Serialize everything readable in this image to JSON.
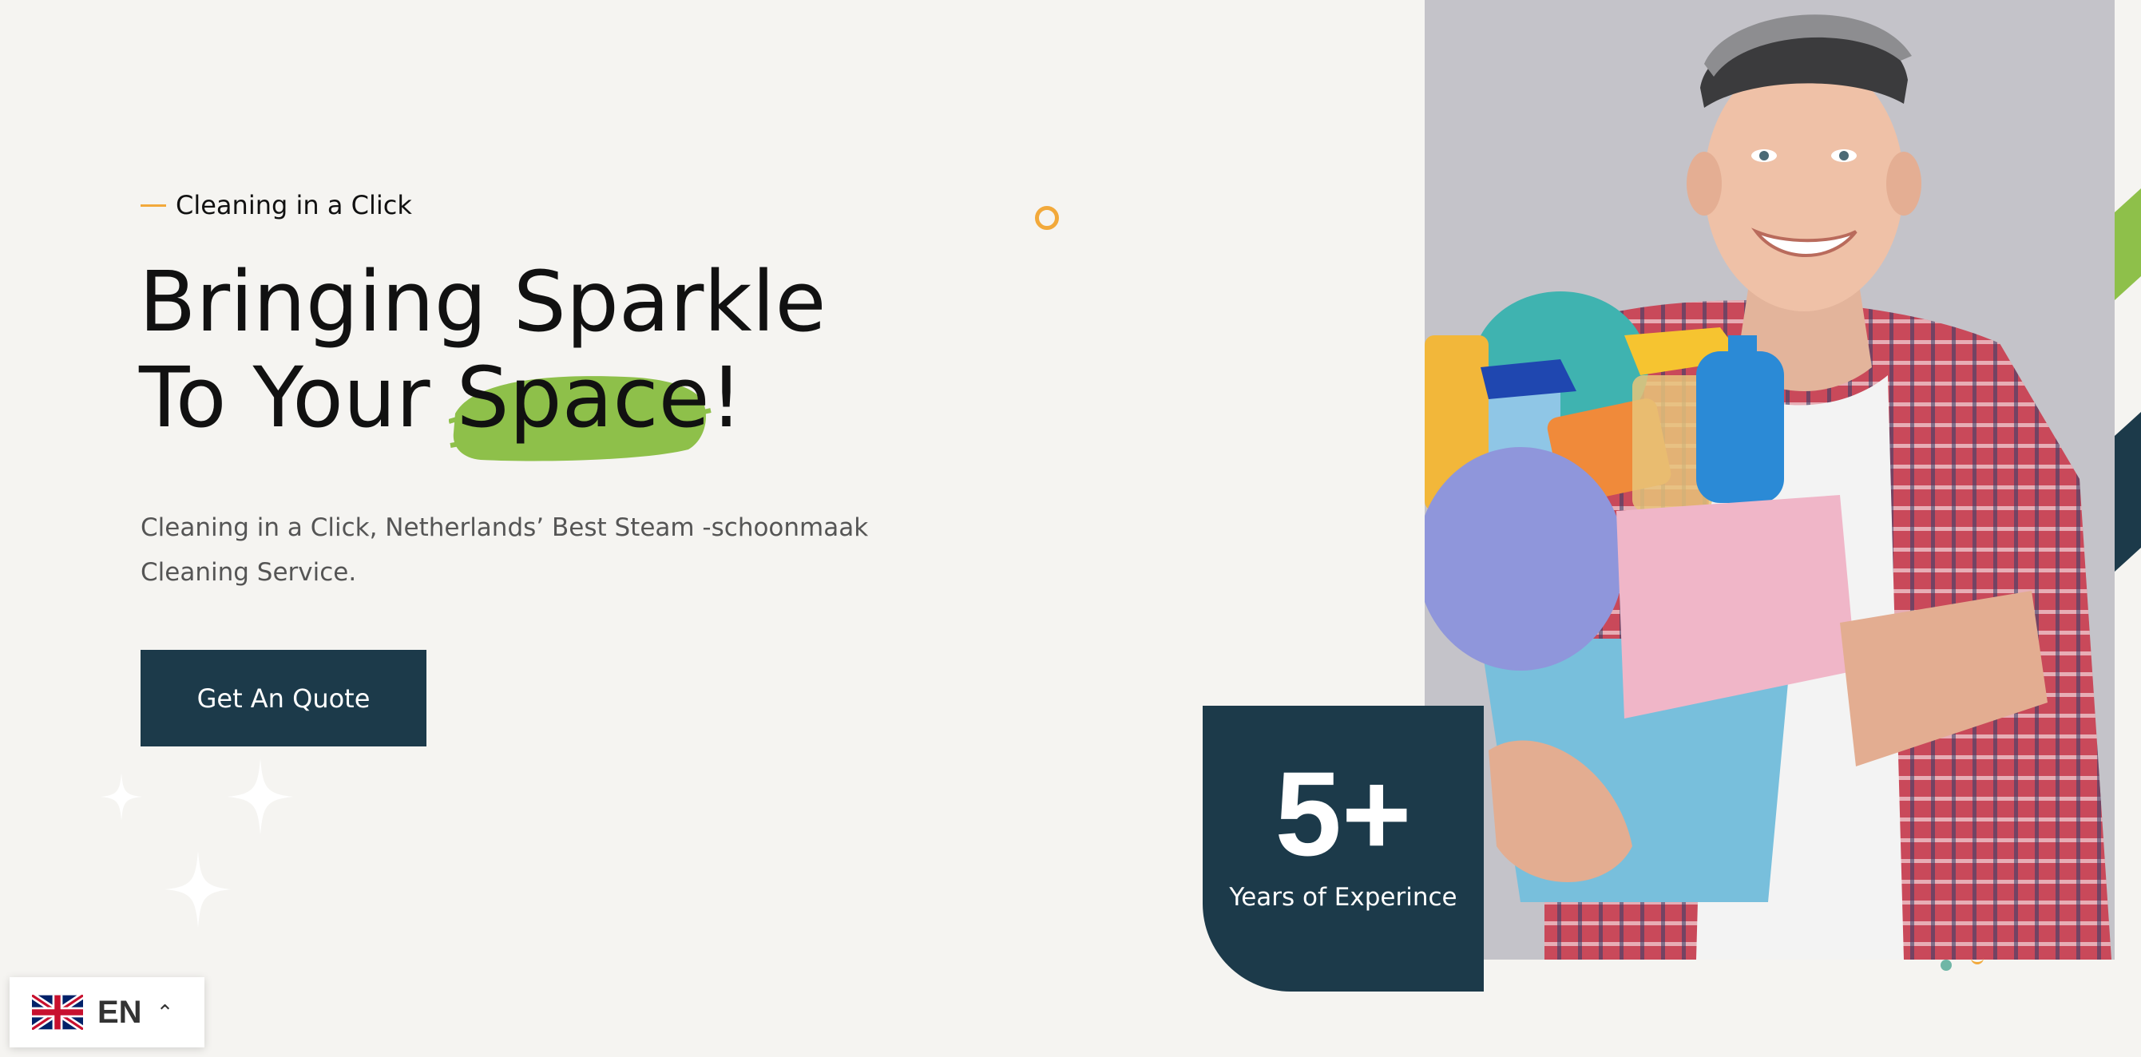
{
  "hero": {
    "tagline": "Cleaning in a Click",
    "headline_line1": "Bringing Sparkle",
    "headline_line2_prefix": "To Your ",
    "headline_highlight": "Space",
    "headline_suffix": "!",
    "description": "Cleaning in a Click, Netherlands’ Best Steam -schoonmaak Cleaning Service.",
    "cta_label": "Get An Quote"
  },
  "experience": {
    "value": "5+",
    "label": "Years of Experince"
  },
  "language": {
    "code": "EN",
    "flag": "uk-flag-icon",
    "chevron": "chevron-up-icon"
  },
  "colors": {
    "navy": "#1c3a4a",
    "highlight_green": "#8ec04a",
    "accent_orange": "#f2a93b",
    "background": "#f5f4f1"
  }
}
